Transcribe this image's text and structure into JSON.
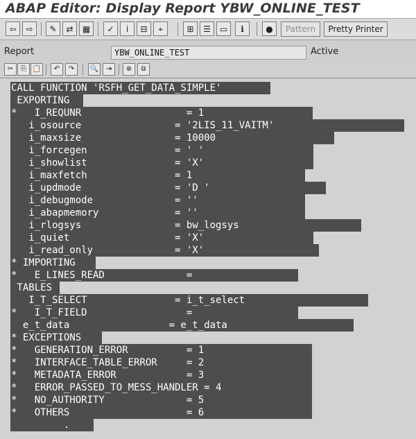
{
  "window": {
    "title": "ABAP Editor: Display Report YBW_ONLINE_TEST"
  },
  "app_toolbar": {
    "buttons": [
      {
        "icon": "back-arrow-icon",
        "glyph": "⇦"
      },
      {
        "icon": "forward-arrow-icon",
        "glyph": "⇨"
      },
      {
        "icon": "display-change-icon",
        "glyph": "✎"
      },
      {
        "icon": "active-inactive-icon",
        "glyph": "⇄"
      },
      {
        "icon": "other-object-icon",
        "glyph": "▦"
      },
      {
        "icon": "check-icon",
        "glyph": "✓"
      },
      {
        "icon": "activate-icon",
        "glyph": "ⅰ"
      },
      {
        "icon": "test-icon",
        "glyph": "⊟"
      },
      {
        "icon": "where-used-icon",
        "glyph": "⌖"
      },
      {
        "icon": "object-list-icon",
        "glyph": "⊞"
      },
      {
        "icon": "navigation-window-icon",
        "glyph": "☰"
      },
      {
        "icon": "display-object-icon",
        "glyph": "▭"
      },
      {
        "icon": "info-icon",
        "glyph": "ℹ"
      },
      {
        "icon": "breakpoint-icon",
        "glyph": "●"
      }
    ],
    "pattern_label": "Pattern",
    "pretty_printer_label": "Pretty Printer"
  },
  "report_header": {
    "label": "Report",
    "value": "YBW_ONLINE_TEST",
    "status": "Active"
  },
  "editor_toolbar": {
    "buttons": [
      {
        "icon": "cut-icon",
        "glyph": "✂"
      },
      {
        "icon": "copy-icon",
        "glyph": "⎘"
      },
      {
        "icon": "paste-icon",
        "glyph": "📋"
      },
      {
        "icon": "undo-icon",
        "glyph": "↶"
      },
      {
        "icon": "redo-icon",
        "glyph": "↷"
      },
      {
        "icon": "find-icon",
        "glyph": "🔍"
      },
      {
        "icon": "find-next-icon",
        "glyph": "⇥"
      },
      {
        "icon": "insert-block-icon",
        "glyph": "⊕"
      },
      {
        "icon": "copy-block-icon",
        "glyph": "⧉"
      }
    ]
  },
  "code": {
    "lines": [
      "CALL FUNCTION 'RSFH_GET_DATA_SIMPLE'",
      " EXPORTING",
      "*   I_REQUNR                  = 1",
      "   i_osource                = '2LIS_11_VAITM'",
      "   i_maxsize                = 10000",
      "   i_forcegen               = ' '",
      "   i_showlist               = 'X'",
      "   i_maxfetch               = 1",
      "   i_updmode                = 'D '",
      "   i_debugmode              = ''",
      "   i_abapmemory             = ''",
      "   i_rlogsys                = bw_logsys",
      "   i_quiet                  = 'X'",
      "   i_read_only              = 'X'",
      "* IMPORTING",
      "*   E_LINES_READ              =",
      " TABLES",
      "   I_T_SELECT               = i_t_select",
      "*   I_T_FIELD                 =",
      "  e_t_data                 = e_t_data",
      "* EXCEPTIONS",
      "*   GENERATION_ERROR          = 1",
      "*   INTERFACE_TABLE_ERROR     = 2",
      "*   METADATA_ERROR            = 3",
      "*   ERROR_PASSED_TO_MESS_HANDLER = 4",
      "*   NO_AUTHORITY              = 5",
      "*   OTHERS                    = 6"
    ],
    "tail": "         ."
  },
  "colors": {
    "selection": "#4d4d4d",
    "editor_background": "#d2d2d2",
    "selected_text": "#ffffff"
  }
}
